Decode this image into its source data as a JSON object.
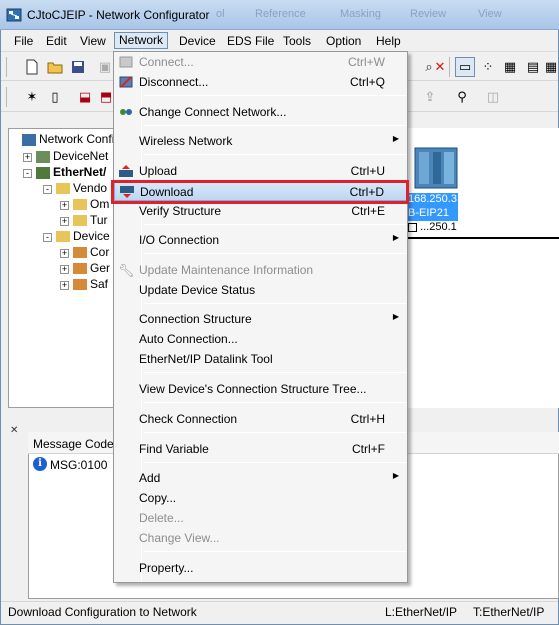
{
  "window": {
    "title": "CJtoCJEIP - Network Configurator",
    "ghost_menus": [
      "ol",
      "Reference",
      "Masking",
      "Review",
      "View"
    ]
  },
  "menubar": [
    "File",
    "Edit",
    "View",
    "Network",
    "Device",
    "EDS File",
    "Tools",
    "Option",
    "Help"
  ],
  "tree": {
    "items": [
      {
        "label": "Network Configu",
        "expander": ""
      },
      {
        "label": "DeviceNet",
        "expander": "+"
      },
      {
        "label": "EtherNet/",
        "expander": "-"
      },
      {
        "label": "Vendo",
        "expander": "-"
      },
      {
        "label": "Om",
        "expander": "+"
      },
      {
        "label": "Tur",
        "expander": "+"
      },
      {
        "label": "Device",
        "expander": "-"
      },
      {
        "label": "Cor",
        "expander": "+"
      },
      {
        "label": "Ger",
        "expander": "+"
      },
      {
        "label": "Saf",
        "expander": "+"
      }
    ]
  },
  "network_view": {
    "ip_label": "168.250.3",
    "model_label": "B-EIP21",
    "node_label": "...250.1"
  },
  "messages": {
    "column_code": "Message Code",
    "rows": [
      {
        "code": "MSG:0100"
      }
    ]
  },
  "status": {
    "text": "Download Configuration to Network",
    "left": "L:EtherNet/IP",
    "right": "T:EtherNet/IP"
  },
  "network_menu": {
    "connect": {
      "label": "Connect...",
      "shortcut": "Ctrl+W"
    },
    "disconnect": {
      "label": "Disconnect...",
      "shortcut": "Ctrl+Q"
    },
    "change_connect_network": {
      "label": "Change Connect Network..."
    },
    "wireless_network": {
      "label": "Wireless Network"
    },
    "upload": {
      "label": "Upload",
      "shortcut": "Ctrl+U"
    },
    "download": {
      "label": "Download",
      "shortcut": "Ctrl+D"
    },
    "verify_structure": {
      "label": "Verify Structure",
      "shortcut": "Ctrl+E"
    },
    "io_connection": {
      "label": "I/O Connection"
    },
    "update_maintenance": {
      "label": "Update Maintenance Information"
    },
    "update_device_status": {
      "label": "Update Device Status"
    },
    "connection_structure": {
      "label": "Connection Structure"
    },
    "auto_connection": {
      "label": "Auto Connection..."
    },
    "datalink_tool": {
      "label": "EtherNet/IP Datalink Tool"
    },
    "view_tree": {
      "label": "View Device's Connection Structure Tree..."
    },
    "check_connection": {
      "label": "Check Connection",
      "shortcut": "Ctrl+H"
    },
    "find_variable": {
      "label": "Find Variable",
      "shortcut": "Ctrl+F"
    },
    "add": {
      "label": "Add"
    },
    "copy": {
      "label": "Copy..."
    },
    "delete": {
      "label": "Delete..."
    },
    "change_view": {
      "label": "Change View..."
    },
    "property": {
      "label": "Property..."
    }
  },
  "colors": {
    "highlight_box": "#e0202a",
    "selection_blue": "#3399ff"
  }
}
